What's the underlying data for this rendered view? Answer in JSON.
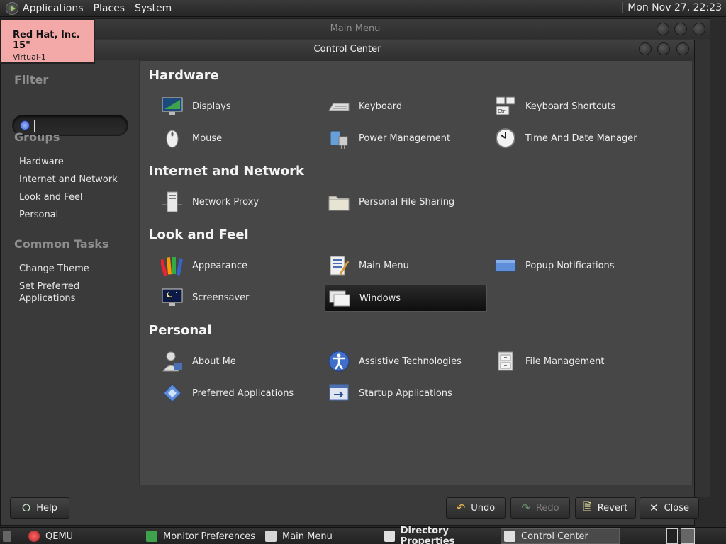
{
  "top_panel": {
    "menus": [
      "Applications",
      "Places",
      "System"
    ],
    "clock": "Mon Nov 27, 22:23"
  },
  "display_badge": {
    "title": "Red Hat, Inc. 15\"",
    "subtitle": "Virtual-1"
  },
  "background_window": {
    "title": "Main Menu"
  },
  "window": {
    "title": "Control Center"
  },
  "sidebar": {
    "filter_heading": "Filter",
    "search_value": "",
    "groups_heading": "Groups",
    "groups": [
      "Hardware",
      "Internet and Network",
      "Look and Feel",
      "Personal"
    ],
    "tasks_heading": "Common Tasks",
    "tasks": [
      "Change Theme",
      "Set Preferred Applications"
    ]
  },
  "sections": [
    {
      "title": "Hardware",
      "items": [
        {
          "label": "Displays",
          "icon": "display-icon"
        },
        {
          "label": "Keyboard",
          "icon": "keyboard-icon"
        },
        {
          "label": "Keyboard Shortcuts",
          "icon": "keyboard-shortcuts-icon"
        },
        {
          "label": "Mouse",
          "icon": "mouse-icon"
        },
        {
          "label": "Power Management",
          "icon": "power-management-icon"
        },
        {
          "label": "Time And Date Manager",
          "icon": "clock-icon"
        }
      ]
    },
    {
      "title": "Internet and Network",
      "items": [
        {
          "label": "Network Proxy",
          "icon": "network-proxy-icon"
        },
        {
          "label": "Personal File Sharing",
          "icon": "folder-share-icon"
        }
      ]
    },
    {
      "title": "Look and Feel",
      "items": [
        {
          "label": "Appearance",
          "icon": "appearance-icon"
        },
        {
          "label": "Main Menu",
          "icon": "main-menu-icon"
        },
        {
          "label": "Popup Notifications",
          "icon": "popup-notifications-icon"
        },
        {
          "label": "Screensaver",
          "icon": "screensaver-icon"
        },
        {
          "label": "Windows",
          "icon": "windows-icon"
        }
      ]
    },
    {
      "title": "Personal",
      "items": [
        {
          "label": "About Me",
          "icon": "about-me-icon"
        },
        {
          "label": "Assistive Technologies",
          "icon": "accessibility-icon"
        },
        {
          "label": "File Management",
          "icon": "file-management-icon"
        },
        {
          "label": "Preferred Applications",
          "icon": "preferred-apps-icon"
        },
        {
          "label": "Startup Applications",
          "icon": "startup-apps-icon"
        }
      ]
    }
  ],
  "buttons": {
    "help": "Help",
    "undo": "Undo",
    "redo": "Redo",
    "revert": "Revert",
    "close": "Close"
  },
  "taskbar": [
    "QEMU",
    "Monitor Preferences",
    "Main Menu",
    "Directory Properties",
    "Control Center"
  ],
  "colors": {
    "panel_bg": "#474747",
    "sidebar_bg": "#3a3a3a",
    "badge_bg": "#f4a9a9",
    "accent_blue": "#3a5fd0"
  }
}
